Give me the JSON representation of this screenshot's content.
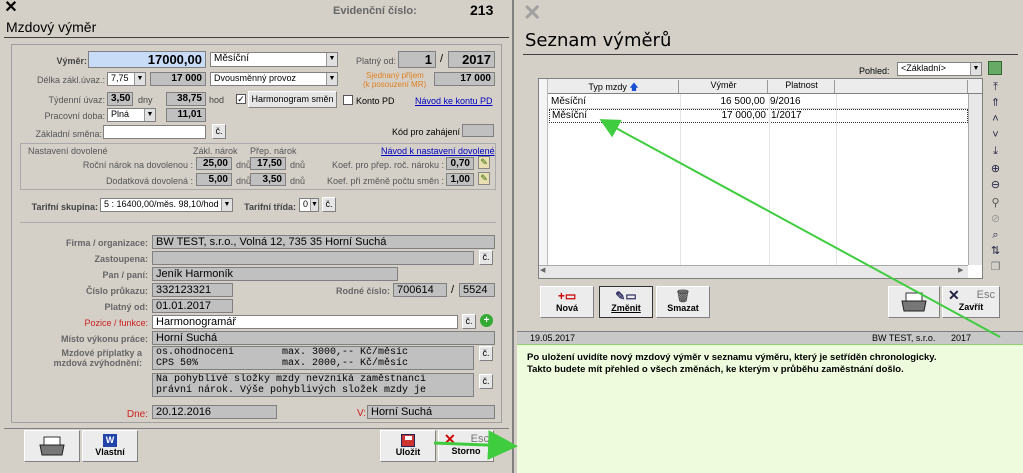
{
  "left": {
    "title": "Mzdový výměr",
    "evid_label": "Evidenční číslo:",
    "evid_value": "213",
    "vymer_label": "Výměr:",
    "vymer_value": "17000,00",
    "vymer_type": "Měsíční",
    "platny_od_label": "Platný od:",
    "platny_od_month": "1",
    "platny_od_sep": "/",
    "platny_od_year": "2017",
    "delka_label": "Délka zákl.úvaz.:",
    "delka_sel": "7,75",
    "delka_val": "17 000",
    "provoz": "Dvousměnný provoz",
    "sjednany_label": "Sjednaný příjem",
    "sjednany_sub": "(k posouzení MR)",
    "sjednany_val": "17 000",
    "tydenni_label": "Týdenní úvaz:",
    "tydenni_val": "3,50",
    "tydenni_unit": "dny",
    "hod_val": "38,75",
    "hod_unit": "hod",
    "checkbox_mark": "✓",
    "harmonogram_btn": "Harmonogram směn",
    "konto_label": "Konto PD",
    "navod_konto": "Návod ke kontu PD",
    "pracovni_label": "Pracovní doba:",
    "pracovni_sel": "Plná",
    "pracovni_val": "11,01",
    "zakladni_label": "Základní směna:",
    "c_btn": "č.",
    "kod_label": "Kód pro zahájení :",
    "dovolena": {
      "section_label": "Nastavení dovolené",
      "col1": "Zákl. nárok",
      "col2": "Přep. nárok",
      "navod": "Návod k nastavení dovolené",
      "rocni_label": "Roční nárok na dovolenou :",
      "rocni_v1": "25,00",
      "rocni_v2": "17,50",
      "unit": "dnů",
      "dodatkova_label": "Dodatková dovolená :",
      "dod_v1": "5,00",
      "dod_v2": "3,50",
      "koef1_label": "Koef. pro přep. roč. nároku :",
      "koef1": "0,70",
      "koef2_label": "Koef. při změně počtu směn :",
      "koef2": "1,00"
    },
    "tarifni_skupina_label": "Tarifní skupina:",
    "tarifni_skupina": "5 : 16400,00/měs. 98,10/hod",
    "tarifni_trida_label": "Tarifní třída:",
    "tarifni_trida": "0",
    "firma_label": "Firma / organizace:",
    "firma": "BW TEST, s.r.o., Volná 12, 735 35   Horní Suchá",
    "zastoupena_label": "Zastoupena:",
    "pan_label": "Pan / paní:",
    "pan": "Jeník  Harmoník",
    "cislo_pruk_label": "Číslo průkazu:",
    "cislo_pruk": "332123321",
    "rodne_label": "Rodné číslo:",
    "rodne1": "700614",
    "rodne_sep": "/",
    "rodne2": "5524",
    "platny_label": "Platný od:",
    "platny": "01.01.2017",
    "pozice_label": "Pozice / funkce:",
    "pozice": "Harmonogramář",
    "misto_label": "Místo výkonu práce:",
    "misto": "Horní Suchá",
    "priplatky_label1": "Mzdové příplatky a",
    "priplatky_label2": "mzdová zvýhodnění:",
    "priplatky": "os.ohodnocení        max. 3000,-- Kč/měsíc\nCPS 50%              max. 2000,-- Kč/měsíc",
    "pohyblive": "Na pohyblivé složky mzdy nevzniká zaměstnanci\nprávní nárok. Výše pohyblivých složek mzdy je",
    "dne_label": "Dne:",
    "dne": "20.12.2016",
    "v_label": "V:",
    "v_place": "Horní Suchá",
    "btn_vlastni": "Vlastní",
    "btn_ulozit": "Uložit",
    "btn_storno": "Storno",
    "esc": "Esc"
  },
  "right": {
    "title": "Seznam výměrů",
    "pohled_label": "Pohled:",
    "pohled": "<Základní>",
    "headers": [
      "Typ mzdy",
      "Výměr",
      "Platnost"
    ],
    "rows": [
      [
        "Měsíční",
        "16 500,00",
        "9/2016"
      ],
      [
        "Měsíční",
        "17 000,00",
        "1/2017"
      ]
    ],
    "btn_nova": "Nová",
    "btn_zmenit": "Změnit",
    "btn_smazat": "Smazat",
    "btn_zavrit": "Zavřít",
    "esc": "Esc",
    "status_date": "19.05.2017",
    "status_firm": "BW TEST, s.r.o.",
    "status_year": "2017"
  },
  "note": {
    "line1": "Po uložení uvidíte nový mzdový výměr v seznamu výměru, který je setříděn chronologicky.",
    "line2": "Takto budete mít přehled o všech změnách, ke kterým v průběhu zaměstnání došlo."
  },
  "colors": {
    "note_bg": "#eefbdc",
    "arrow": "#3fcc3f",
    "link": "#0000c0"
  }
}
